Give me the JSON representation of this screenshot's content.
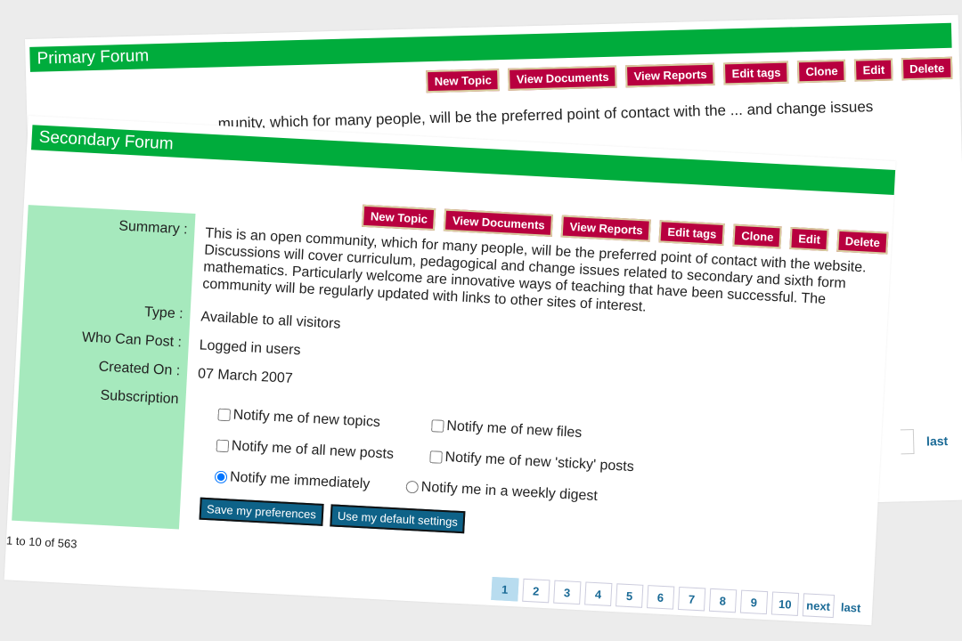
{
  "primary": {
    "title": "Primary Forum",
    "actions": [
      "New Topic",
      "View Documents",
      "View Reports",
      "Edit tags",
      "Clone",
      "Edit",
      "Delete"
    ],
    "summary_fragment": "...munity, which for many people, will be the preferred point of contact with the ... and change issues related to primary",
    "last_label": "last"
  },
  "secondary": {
    "title": "Secondary Forum",
    "actions": [
      "New Topic",
      "View Documents",
      "View Reports",
      "Edit tags",
      "Clone",
      "Edit",
      "Delete"
    ],
    "labels": {
      "summary": "Summary :",
      "type": "Type :",
      "who": "Who Can Post :",
      "created": "Created On :",
      "subscription": "Subscription"
    },
    "summary": "This is an open community, which for many people, will be the preferred point of contact with the website. Discussions will cover curriculum, pedagogical and change issues related to secondary and sixth form mathematics. Particularly welcome are innovative ways of teaching that have been successful. The community will be regularly updated with links to other sites of interest.",
    "type": "Available to all visitors",
    "who": "Logged in users",
    "created": "07 March 2007",
    "options": {
      "new_topics": "Notify me of new topics",
      "new_files": "Notify me of new files",
      "all_posts": "Notify me of all new posts",
      "sticky": "Notify me of new 'sticky' posts",
      "immediately": "Notify me immediately",
      "weekly": "Notify me in a weekly digest"
    },
    "save_label": "Save my preferences",
    "default_label": "Use my default settings",
    "count": "1 to 10 of 563",
    "pages": [
      "1",
      "2",
      "3",
      "4",
      "5",
      "6",
      "7",
      "8",
      "9",
      "10"
    ],
    "current_page": "1",
    "next_label": "next",
    "last_label": "last"
  },
  "colors": {
    "header": "#00ac3c",
    "action": "#b8003f",
    "panel": "#a6e9bd",
    "button": "#0e6288",
    "link": "#1a6a96"
  }
}
